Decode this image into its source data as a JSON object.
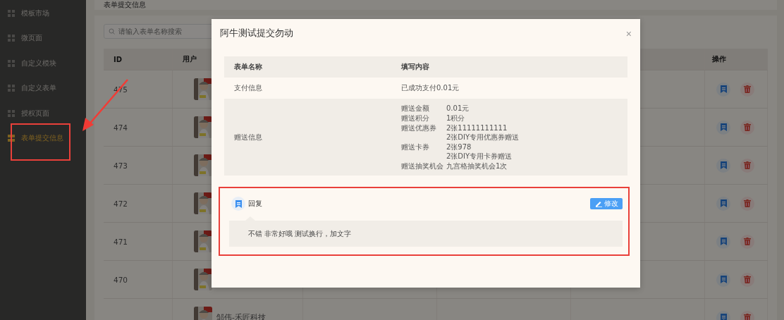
{
  "sidebar": {
    "items": [
      {
        "label": "模板市场",
        "selected": false
      },
      {
        "label": "微页面",
        "selected": false
      },
      {
        "label": "自定义模块",
        "selected": false
      },
      {
        "label": "自定义表单",
        "selected": false
      },
      {
        "label": "授权页面",
        "selected": false
      },
      {
        "label": "表单提交信息",
        "selected": true
      }
    ]
  },
  "page": {
    "title": "表单提交信息",
    "search": {
      "placeholder": "请输入表单名称搜索"
    }
  },
  "table": {
    "columns": [
      "ID",
      "用户",
      "操作"
    ],
    "rows": [
      {
        "id": "475"
      },
      {
        "id": "474"
      },
      {
        "id": "473"
      },
      {
        "id": "472"
      },
      {
        "id": "471"
      },
      {
        "id": "470"
      },
      {
        "user": "邹伟-禾匠科技"
      }
    ]
  },
  "modal": {
    "title": "阿牛测试提交勿动",
    "close": "×",
    "columns": [
      "表单名称",
      "填写内容"
    ],
    "rows": [
      {
        "kind": "text",
        "label": "支付信息",
        "value": "已成功支付0.01元"
      },
      {
        "kind": "details",
        "label": "赠送信息",
        "details": [
          {
            "key": "赠送金额",
            "lines": [
              "0.01元"
            ]
          },
          {
            "key": "赠送积分",
            "lines": [
              "1积分"
            ]
          },
          {
            "key": "赠送优惠券",
            "lines": [
              "2张11111111111",
              "2张DIY专用优惠券赠送"
            ]
          },
          {
            "key": "赠送卡券",
            "lines": [
              "2张978",
              "2张DIY专用卡券赠送"
            ]
          },
          {
            "key": "赠送抽奖机会",
            "lines": [
              "九宫格抽奖机会1次"
            ]
          }
        ]
      }
    ],
    "reply": {
      "label": "回复",
      "button": "修改",
      "content": "不错 非常好哦 测试换行，加文字"
    }
  }
}
